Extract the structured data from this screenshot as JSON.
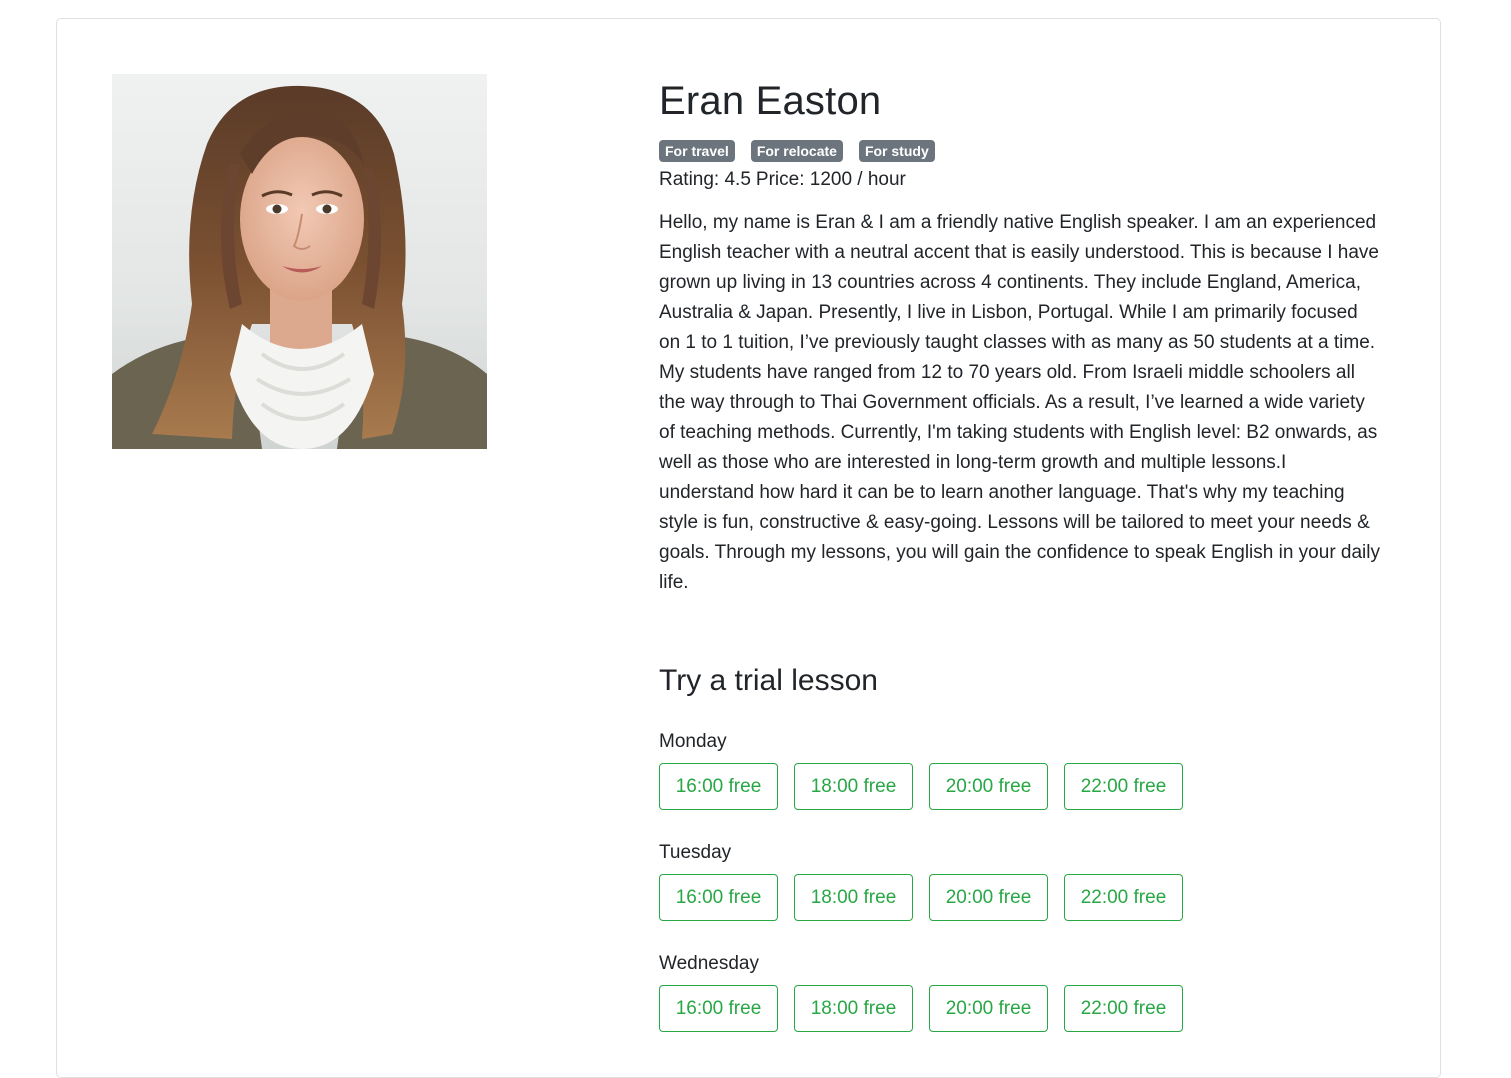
{
  "tutor": {
    "name": "Eran Easton",
    "badges": [
      "For travel",
      "For relocate",
      "For study"
    ],
    "rating_text": "Rating: 4.5",
    "price_text": "Price: 1200 / hour",
    "bio": "Hello, my name is Eran & I am a friendly native English speaker. I am an experienced English teacher with a neutral accent that is easily understood. This is because I have grown up living in 13 countries across 4 continents. They include England, America, Australia & Japan. Presently, I live in Lisbon, Portugal. While I am primarily focused on 1 to 1 tuition, I’ve previously taught classes with as many as 50 students at a time. My students have ranged from 12 to 70 years old. From Israeli middle schoolers all the way through to Thai Government officials. As a result, I’ve learned a wide variety of teaching methods. Currently, I'm taking students with English level: B2 onwards, as well as those who are interested in long-term growth and multiple lessons.I understand how hard it can be to learn another language. That's why my teaching style is fun, constructive & easy-going. Lessons will be tailored to meet your needs & goals. Through my lessons, you will gain the confidence to speak English in your daily life."
  },
  "trial": {
    "title": "Try a trial lesson",
    "days": [
      {
        "label": "Monday",
        "slots": [
          "16:00 free",
          "18:00 free",
          "20:00 free",
          "22:00 free"
        ]
      },
      {
        "label": "Tuesday",
        "slots": [
          "16:00 free",
          "18:00 free",
          "20:00 free",
          "22:00 free"
        ]
      },
      {
        "label": "Wednesday",
        "slots": [
          "16:00 free",
          "18:00 free",
          "20:00 free",
          "22:00 free"
        ]
      }
    ]
  },
  "colors": {
    "badge_bg": "#6c757d",
    "slot_green": "#28a745",
    "text": "#212529"
  }
}
